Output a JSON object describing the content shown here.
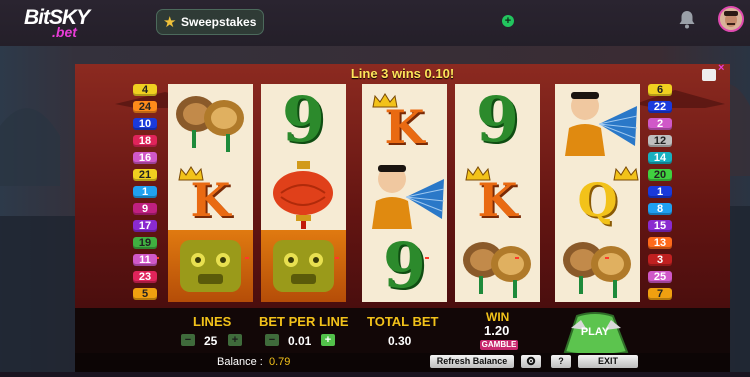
{
  "site": {
    "logo_main": "BitSKY",
    "logo_sub": ".bet",
    "sweepstakes_label": "Sweepstakes",
    "plus_symbol": "+"
  },
  "game": {
    "banner": "Line 3 wins 0.10!",
    "close_symbol": "×",
    "left_lines": [
      "4",
      "24",
      "10",
      "18",
      "16",
      "21",
      "1",
      "9",
      "17",
      "19",
      "11",
      "23",
      "5"
    ],
    "right_lines": [
      "6",
      "22",
      "2",
      "12",
      "14",
      "20",
      "1",
      "8",
      "15",
      "13",
      "3",
      "25",
      "7"
    ],
    "reels": [
      [
        "cymbals",
        "K",
        "lion"
      ],
      [
        "9",
        "lantern",
        "lion"
      ],
      [
        "K",
        "fan-boy",
        "9"
      ],
      [
        "9",
        "K",
        "cymbals"
      ],
      [
        "fan-boy",
        "Q",
        "cymbals"
      ]
    ],
    "controls": {
      "lines_label": "LINES",
      "lines_value": "25",
      "bet_label": "BET PER LINE",
      "bet_value": "0.01",
      "total_label": "TOTAL BET",
      "total_value": "0.30",
      "win_label": "WIN",
      "win_value": "1.20",
      "gamble_label": "GAMBLE",
      "play_label": "PLAY",
      "minus_symbol": "−",
      "plus_symbol": "+"
    },
    "footer": {
      "balance_label": "Balance :",
      "balance_value": "0.79",
      "refresh_label": "Refresh Balance",
      "help_label": "?",
      "exit_label": "EXIT"
    }
  },
  "colors": {
    "brand_pink": "#e83cd6",
    "gold": "#f2c21a",
    "green_play": "#5cc44e"
  }
}
